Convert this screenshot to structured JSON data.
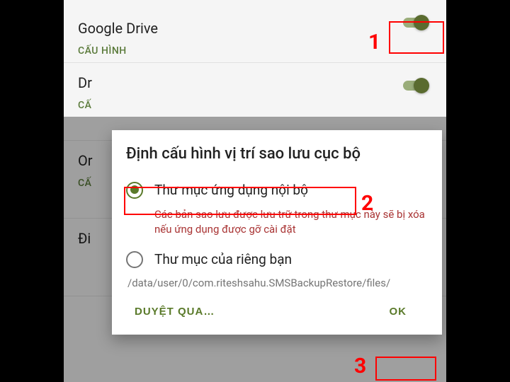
{
  "list": {
    "items": [
      {
        "title": "Google Drive",
        "config": "CẤU HÌNH"
      },
      {
        "title": "Dr",
        "config": "CẤ"
      },
      {
        "title": "Or",
        "config": "CẤ"
      },
      {
        "title": "Đi",
        "config": ""
      }
    ]
  },
  "dialog": {
    "title": "Định cấu hình vị trí sao lưu cục bộ",
    "option1": {
      "label": "Thư mục ứng dụng nội bộ",
      "desc": "Các bản sao lưu được lưu trữ trong thư mục này sẽ bị xóa nếu ứng dụng được gỡ cài đặt"
    },
    "option2": {
      "label": "Thư mục của riêng bạn"
    },
    "path": "/data/user/0/com.riteshsahu.SMSBackupRestore/files/",
    "browse": "DUYỆT QUA…",
    "ok": "OK"
  },
  "annotations": {
    "n1": "1",
    "n2": "2",
    "n3": "3"
  }
}
